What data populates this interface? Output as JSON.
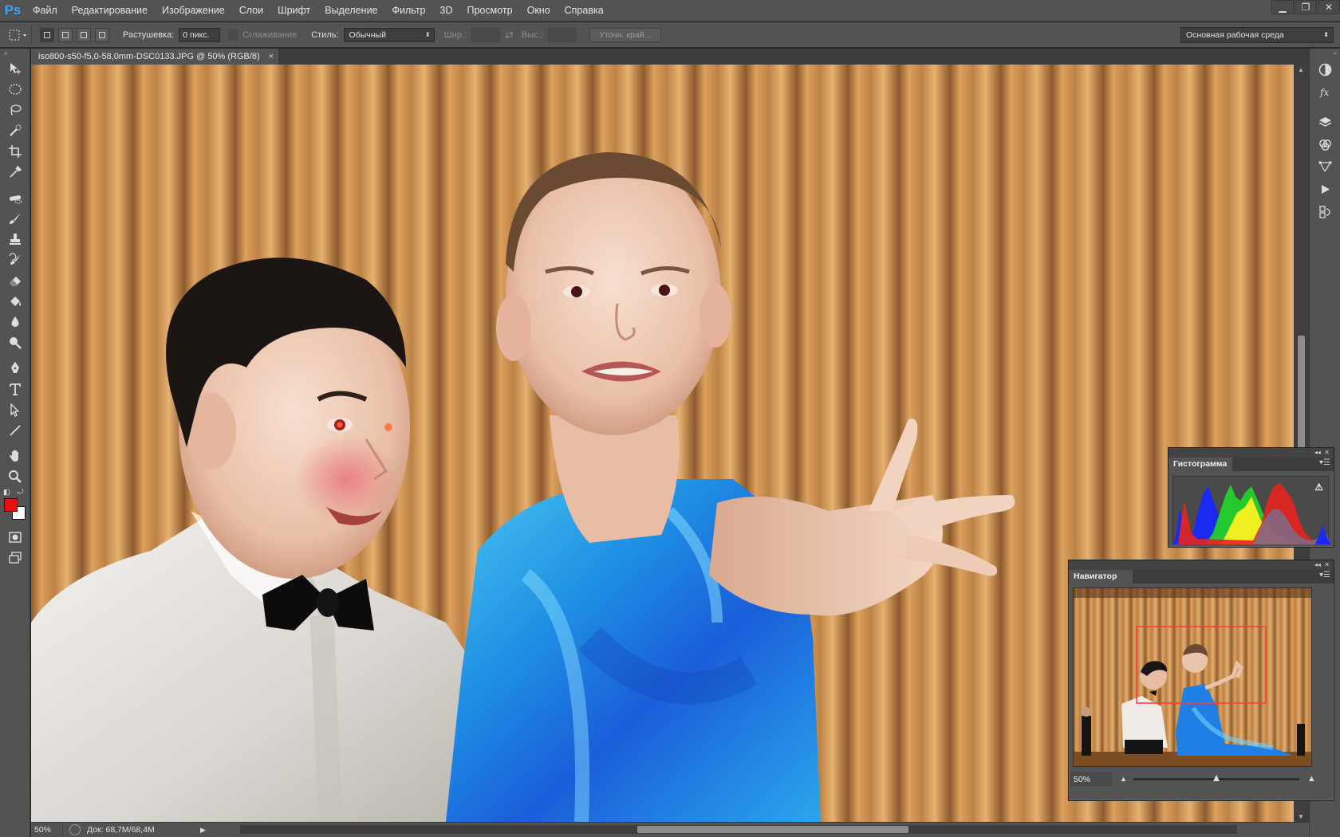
{
  "app": {
    "logo": "Ps",
    "menu": [
      "Файл",
      "Редактирование",
      "Изображение",
      "Слои",
      "Шрифт",
      "Выделение",
      "Фильтр",
      "3D",
      "Просмотр",
      "Окно",
      "Справка"
    ],
    "window_controls": {
      "minimize": "▁",
      "restore": "❐",
      "close": "✕"
    }
  },
  "options": {
    "feather_label": "Растушевка:",
    "feather_value": "0 пикс.",
    "antialias_label": "Сглаживание",
    "style_label": "Стиль:",
    "style_value": "Обычный",
    "width_label": "Шир.:",
    "height_label": "Выс.:",
    "refine_edge": "Уточн. край...",
    "workspace": "Основная рабочая среда"
  },
  "document": {
    "tab_title": "iso800-s50-f5,0-58,0mm-DSC0133.JPG @ 50% (RGB/8)",
    "close_glyph": "×"
  },
  "tools": [
    "move-icon",
    "ellipse-marquee-icon",
    "lasso-icon",
    "quick-selection-icon",
    "crop-icon",
    "eyedropper-icon",
    "spot-healing-icon",
    "brush-icon",
    "clone-stamp-icon",
    "history-brush-icon",
    "eraser-icon",
    "paint-bucket-icon",
    "blur-icon",
    "dodge-icon",
    "pen-icon",
    "type-icon",
    "path-selection-icon",
    "line-icon",
    "hand-icon",
    "zoom-icon"
  ],
  "colors": {
    "foreground": "#e8110f",
    "background": "#ffffff",
    "accent": "#31a8ff"
  },
  "status": {
    "zoom": "50%",
    "doc_info": "Док: 68,7M/68,4M"
  },
  "dock_icons": [
    "adjustments-icon",
    "styles-icon",
    "layers-icon",
    "channels-icon",
    "paths-icon",
    "actions-icon",
    "history-icon"
  ],
  "histogram_panel": {
    "title": "Гистограмма",
    "warning_glyph": "⚠"
  },
  "navigator_panel": {
    "title": "Навигатор",
    "zoom": "50%",
    "zoom_level": 0.5
  }
}
